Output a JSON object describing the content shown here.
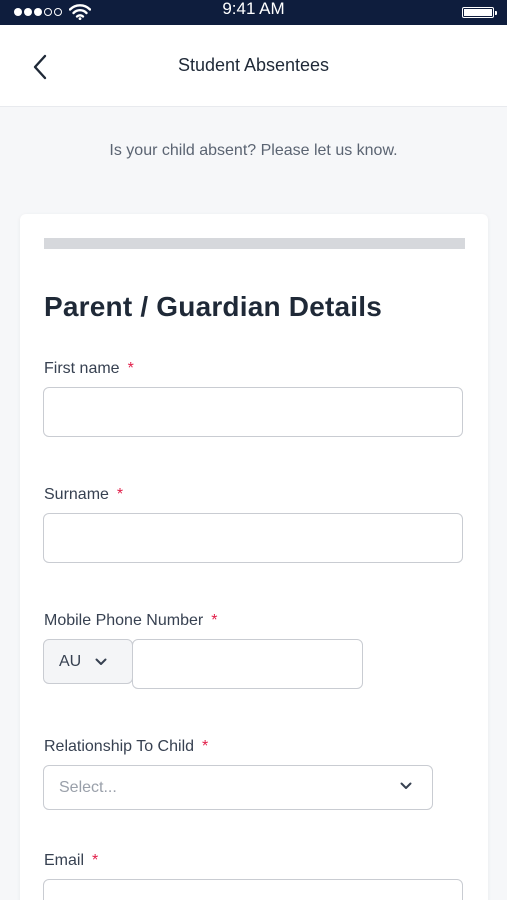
{
  "status_bar": {
    "time": "9:41 AM",
    "signal_bars": 5,
    "signal_filled": 3,
    "battery_level": 1.0
  },
  "nav": {
    "title": "Student Absentees",
    "back_icon": "chevron-left-icon"
  },
  "subtitle": "Is your child absent? Please let us know.",
  "form": {
    "progress": 0.0,
    "section_title": "Parent / Guardian Details",
    "required_marker": "*",
    "fields": {
      "first_name": {
        "label": "First name",
        "value": "",
        "placeholder": ""
      },
      "surname": {
        "label": "Surname",
        "value": "",
        "placeholder": ""
      },
      "mobile": {
        "label": "Mobile Phone Number",
        "country_code": "AU",
        "value": "",
        "placeholder": ""
      },
      "relationship": {
        "label": "Relationship To Child",
        "placeholder": "Select..."
      },
      "email": {
        "label": "Email",
        "value": "",
        "placeholder": ""
      }
    }
  },
  "colors": {
    "status_bar_bg": "#0e1d3d",
    "required": "#e11d48",
    "page_bg": "#f6f7f9"
  }
}
